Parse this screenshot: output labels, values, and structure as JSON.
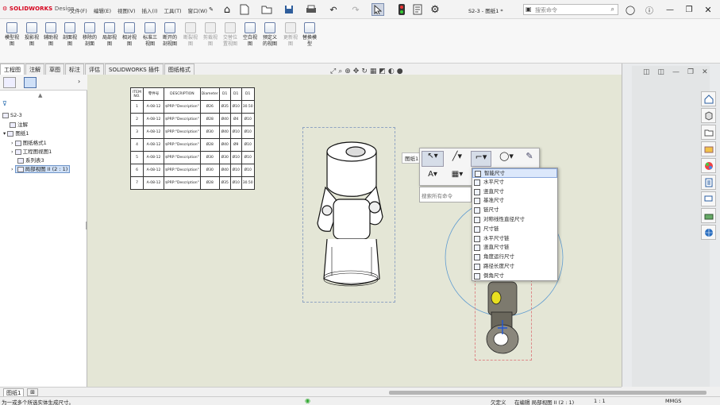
{
  "app": {
    "logo": "SOLIDWORKS",
    "logo_sub": "Design",
    "doc_title": "S2-3 - 图纸1 *"
  },
  "menus": [
    "文件(F)",
    "编辑(E)",
    "视图(V)",
    "插入(I)",
    "工具(T)",
    "窗口(W)"
  ],
  "search": {
    "placeholder": "搜索命令"
  },
  "commands": [
    {
      "label": "模型视\n图",
      "enabled": true
    },
    {
      "label": "投影视\n图",
      "enabled": true
    },
    {
      "label": "辅助视\n图",
      "enabled": true
    },
    {
      "label": "剖面视\n图",
      "enabled": true
    },
    {
      "label": "移除的\n剖面",
      "enabled": true
    },
    {
      "label": "局部视\n图",
      "enabled": true
    },
    {
      "label": "相对视\n图",
      "enabled": true
    },
    {
      "label": "标准三\n视图",
      "enabled": true
    },
    {
      "label": "断开的\n剖视图",
      "enabled": true
    },
    {
      "label": "断裂视\n图",
      "enabled": false
    },
    {
      "label": "剪裁视\n图",
      "enabled": false
    },
    {
      "label": "交替位\n置视图",
      "enabled": false
    },
    {
      "label": "空白视\n图",
      "enabled": true
    },
    {
      "label": "预定义\n的视图",
      "enabled": true
    },
    {
      "label": "更新视\n图",
      "enabled": false
    },
    {
      "label": "替换模\n型",
      "enabled": true
    }
  ],
  "tabs": [
    "工程图",
    "注解",
    "草图",
    "标注",
    "评估",
    "SOLIDWORKS 插件",
    "图纸格式"
  ],
  "tree": {
    "root": "S2-3",
    "items": [
      {
        "label": "注解",
        "indent": 1
      },
      {
        "label": "图纸1",
        "indent": 1
      },
      {
        "label": "图纸格式1",
        "indent": 2
      },
      {
        "label": "工程图视图1",
        "indent": 2
      },
      {
        "label": "系列表3",
        "indent": 2
      },
      {
        "label": "局部视图 II (2 : 1)",
        "indent": 2,
        "selected": true
      }
    ]
  },
  "bom": {
    "headers": [
      "ITEM NO.",
      "零件号",
      "DESCRIPTION",
      "Diameter",
      "D1",
      "D1",
      "D1"
    ],
    "rows": [
      [
        "1",
        "A-08-12",
        "$PRP:\"Description\"",
        "Ø26",
        "Ø35",
        "Ø10",
        "30.50"
      ],
      [
        "2",
        "A-08-12",
        "$PRP:\"Description\"",
        "Ø28",
        "Ø40",
        "Ø4",
        "Ø10"
      ],
      [
        "3",
        "A-08-12",
        "$PRP:\"Description\"",
        "Ø30",
        "Ø40",
        "Ø10",
        "Ø10"
      ],
      [
        "4",
        "A-08-12",
        "$PRP:\"Description\"",
        "Ø28",
        "Ø40",
        "Ø9",
        "Ø10"
      ],
      [
        "5",
        "A-08-12",
        "$PRP:\"Description\"",
        "Ø30",
        "Ø30",
        "Ø10",
        "Ø10"
      ],
      [
        "6",
        "A-08-12",
        "$PRP:\"Description\"",
        "Ø30",
        "Ø40",
        "Ø10",
        "Ø10"
      ],
      [
        "7",
        "A-08-12",
        "$PRP:\"Description\"",
        "Ø28",
        "Ø35",
        "Ø10",
        "30.50"
      ]
    ]
  },
  "context": {
    "sheet_label": "图纸1",
    "search_placeholder": "搜索所有命令"
  },
  "dropdown": [
    "智能尺寸",
    "水平尺寸",
    "竖直尺寸",
    "基准尺寸",
    "链尺寸",
    "对称线性直径尺寸",
    "尺寸链",
    "水平尺寸链",
    "竖直尺寸链",
    "角度运行尺寸",
    "路径长度尺寸",
    "倒角尺寸"
  ],
  "sheet_tab": "图纸1",
  "status": {
    "hint": "为一或多个所选实体生成尺寸。",
    "define": "欠定义",
    "editing": "在编辑 局部视图 II (2 : 1)",
    "scale": "1 : 1",
    "units": "MMGS"
  }
}
